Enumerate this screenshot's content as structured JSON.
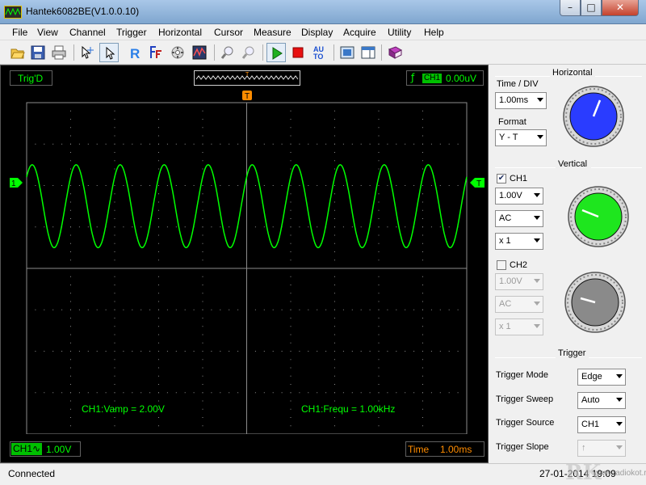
{
  "window": {
    "title": "Hantek6082BE(V1.0.0.10)",
    "minimize_glyph": "–",
    "maximize_glyph": "□",
    "close_glyph": "✕"
  },
  "menu": {
    "items": [
      "File",
      "View",
      "Channel",
      "Trigger",
      "Horizontal",
      "Cursor",
      "Measure",
      "Display",
      "Acquire",
      "Utility",
      "Help"
    ]
  },
  "toolbar": {
    "buttons": [
      "open-icon",
      "save-icon",
      "print-icon",
      "cursor-crosshair-icon",
      "pointer-icon",
      "reference-icon",
      "fft-icon",
      "math-icon",
      "waveform-icon",
      "zoom-in-icon",
      "zoom-out-icon",
      "run-icon",
      "stop-icon",
      "auto-icon",
      "fullscreen-icon",
      "split-view-icon",
      "book-icon"
    ],
    "reference_label": "R",
    "auto_label_top": "AU",
    "auto_label_bottom": "TO"
  },
  "scope": {
    "trig_status": "Trig'D",
    "trigger_position_marker": "T",
    "trigger_channel_badge": "CH1",
    "trigger_slope_glyph": "ƒ",
    "trigger_level": "0.00uV",
    "ch1_marker": "1",
    "trigger_level_marker": "T",
    "measure_vamp": "CH1:Vamp = 2.00V",
    "measure_freq": "CH1:Frequ = 1.00kHz",
    "ch1_badge": "CH1",
    "ch1_coupling_glyph": "∿",
    "ch1_scale": "1.00V",
    "time_label": "Time",
    "time_value": "1.00ms",
    "colors": {
      "trace": "#00ff00",
      "grid": "#8c8c8c",
      "marker": "#ff8c00"
    }
  },
  "chart_data": {
    "type": "line",
    "series": [
      {
        "name": "CH1",
        "waveform": "sine",
        "amplitude_vpp": 2.0,
        "frequency_khz": 1.0,
        "cycles_on_screen": 10
      }
    ],
    "x_divisions": 10,
    "y_divisions": 8,
    "grid": true
  },
  "horizontal": {
    "header": "Horizontal",
    "time_div_label": "Time / DIV",
    "time_div_value": "1.00ms",
    "format_label": "Format",
    "format_value": "Y - T",
    "knob_color": "#2a3cff"
  },
  "vertical": {
    "header": "Vertical",
    "ch1_label": "CH1",
    "ch1_checked": "✔",
    "ch1_volts": "1.00V",
    "ch1_coupling": "AC",
    "ch1_probe": "x 1",
    "ch1_knob_color": "#1ee61e",
    "ch2_label": "CH2",
    "ch2_volts": "1.00V",
    "ch2_coupling": "AC",
    "ch2_probe": "x 1",
    "ch2_knob_color": "#8a8a8a"
  },
  "trigger": {
    "header": "Trigger",
    "mode_label": "Trigger Mode",
    "mode_value": "Edge",
    "sweep_label": "Trigger Sweep",
    "sweep_value": "Auto",
    "source_label": "Trigger Source",
    "source_value": "CH1",
    "slope_label": "Trigger Slope",
    "slope_value": "↑"
  },
  "status": {
    "connection": "Connected",
    "datetime": "27-01-2014 19:09"
  },
  "watermark": {
    "logo": "Radio Kot",
    "text": "www.radiokot.ru"
  }
}
